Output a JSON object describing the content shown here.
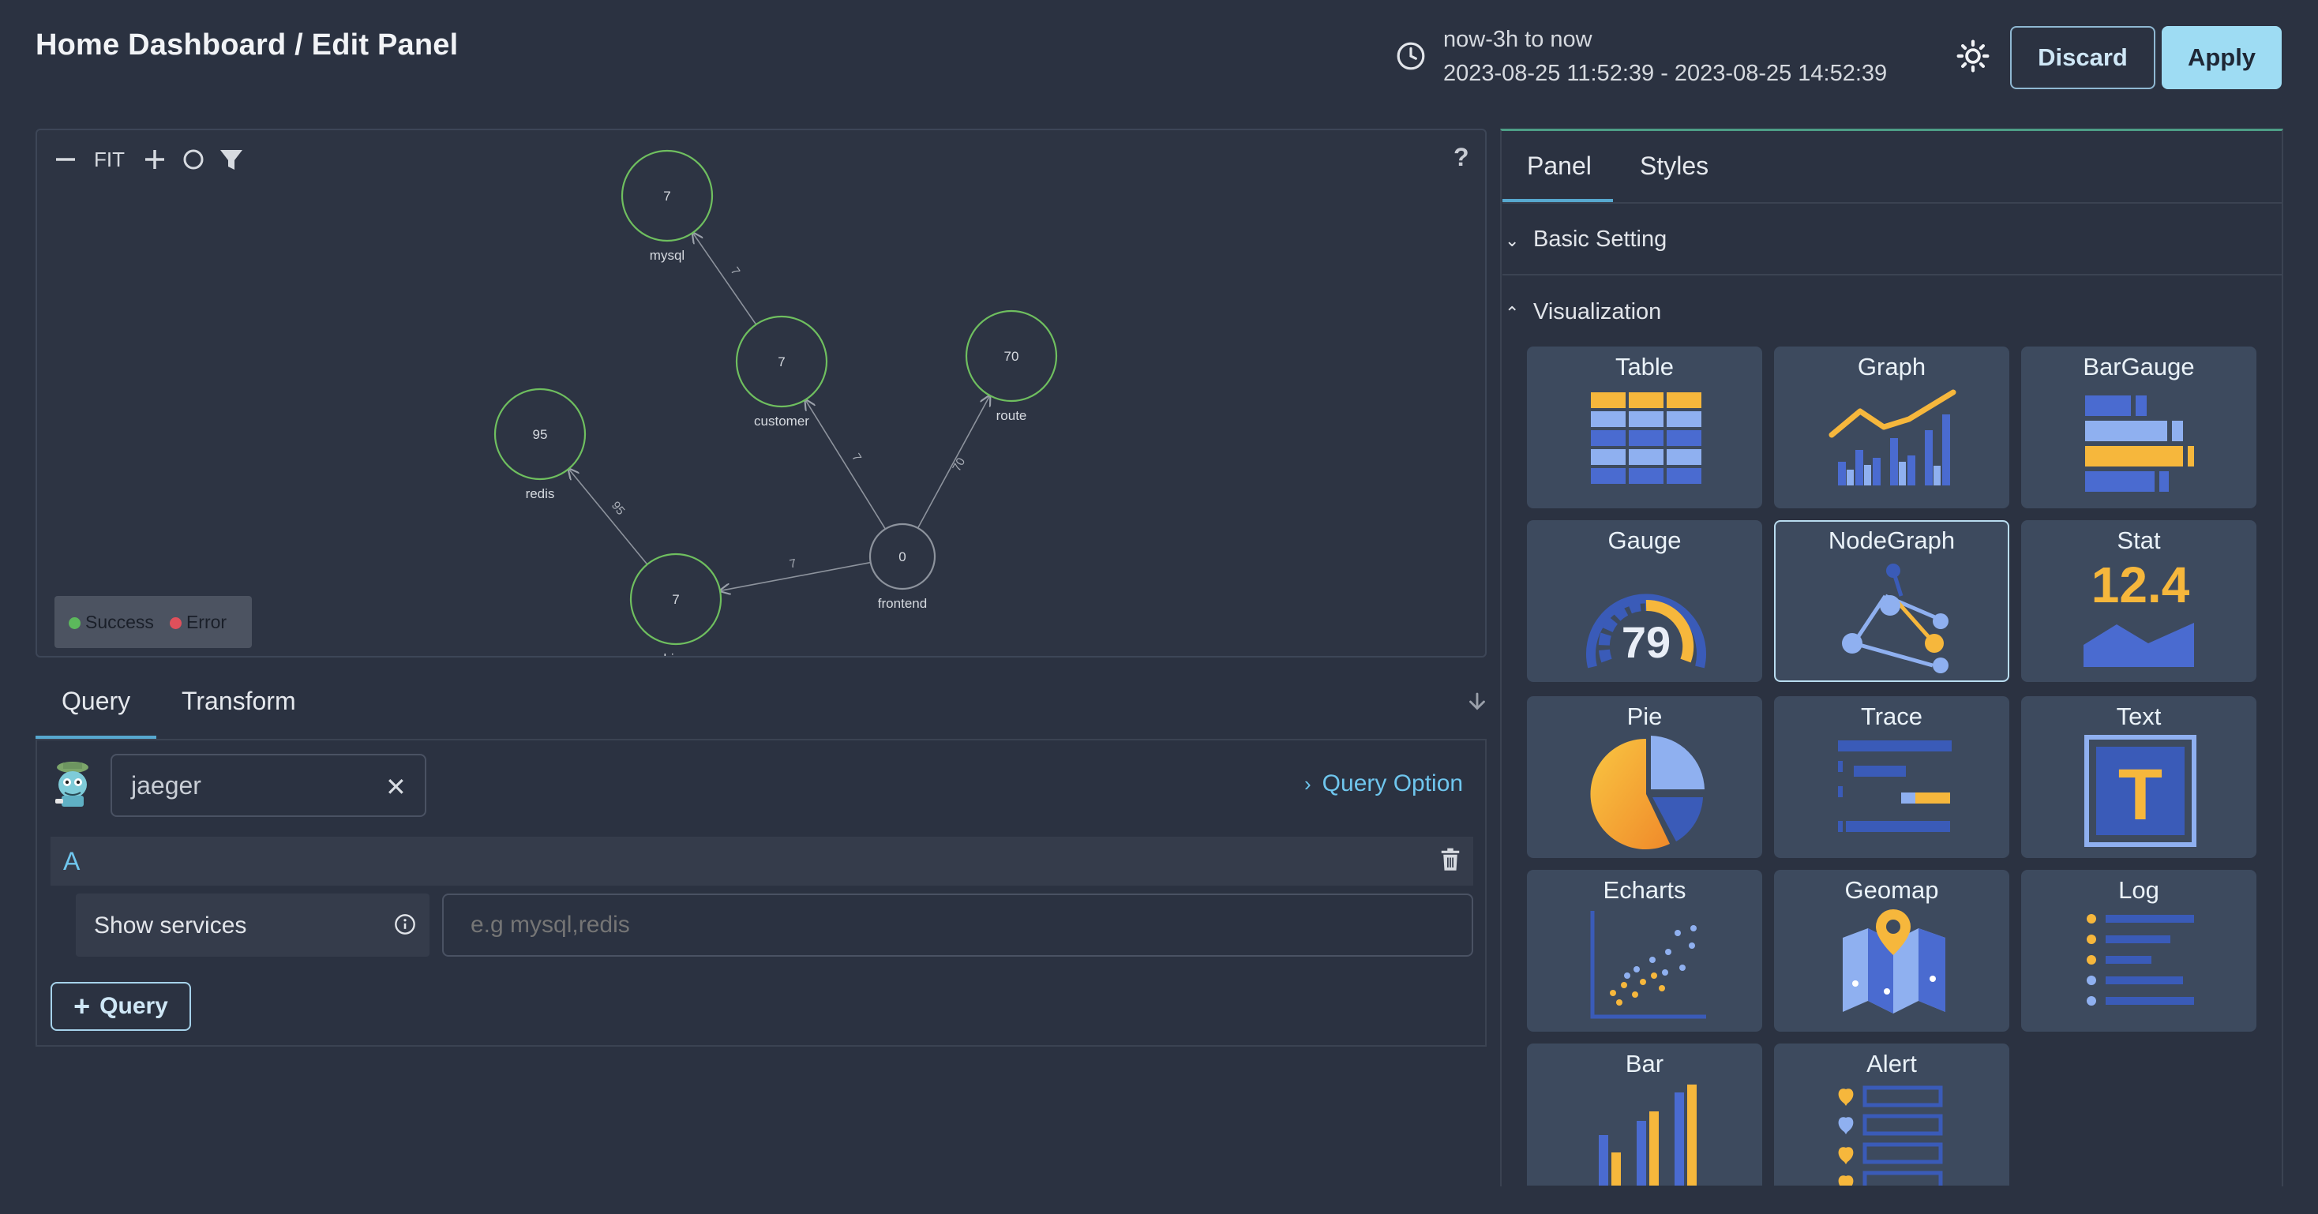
{
  "header": {
    "title": "Home Dashboard / Edit Panel",
    "time_relative": "now-3h to now",
    "time_absolute": "2023-08-25 11:52:39 - 2023-08-25 14:52:39",
    "discard_label": "Discard",
    "apply_label": "Apply"
  },
  "graph_toolbar": {
    "zoom_out_icon": "minus-icon",
    "fit_label": "FIT",
    "zoom_in_icon": "plus-icon",
    "layout_icon": "circle-icon",
    "filter_icon": "filter-icon",
    "help_label": "?"
  },
  "node_graph": {
    "nodes": [
      {
        "id": "mysql",
        "label": "mysql",
        "value": "7"
      },
      {
        "id": "customer",
        "label": "customer",
        "value": "7"
      },
      {
        "id": "route",
        "label": "route",
        "value": "70"
      },
      {
        "id": "redis",
        "label": "redis",
        "value": "95"
      },
      {
        "id": "frontend",
        "label": "frontend",
        "value": "0"
      },
      {
        "id": "driver",
        "label": "driver",
        "value": "7"
      }
    ],
    "edges": [
      {
        "from": "customer",
        "to": "mysql",
        "label": "7"
      },
      {
        "from": "frontend",
        "to": "customer",
        "label": "7"
      },
      {
        "from": "frontend",
        "to": "route",
        "label": "70"
      },
      {
        "from": "frontend",
        "to": "driver",
        "label": "7"
      },
      {
        "from": "driver",
        "to": "redis",
        "label": "95"
      }
    ],
    "legend": [
      {
        "label": "Success",
        "color": "#5cb85c"
      },
      {
        "label": "Error",
        "color": "#e0505b"
      }
    ],
    "node_stroke_color": "#6fbf5f"
  },
  "query_tabs": [
    "Query",
    "Transform"
  ],
  "query": {
    "datasource": "jaeger",
    "query_option_label": "Query Option",
    "row_label": "A",
    "show_services_label": "Show services",
    "show_services_placeholder": "e.g mysql,redis",
    "add_query_label": "Query"
  },
  "right_panel": {
    "tabs": [
      "Panel",
      "Styles"
    ],
    "basic_setting": "Basic Setting",
    "visualization": "Visualization",
    "selected": "NodeGraph",
    "visualizations": [
      "Table",
      "Graph",
      "BarGauge",
      "Gauge",
      "NodeGraph",
      "Stat",
      "Pie",
      "Trace",
      "Text",
      "Echarts",
      "Geomap",
      "Log",
      "Bar",
      "Alert"
    ],
    "gauge_value": "79",
    "stat_value": "12.4",
    "text_glyph": "T"
  },
  "colors": {
    "accent": "#57a8cf",
    "apply_bg": "#9edcf3",
    "link": "#6fc6ee",
    "icon_blue": "#3a5bb8",
    "icon_light_blue": "#8fb0f0",
    "icon_orange": "#f6b73c"
  }
}
